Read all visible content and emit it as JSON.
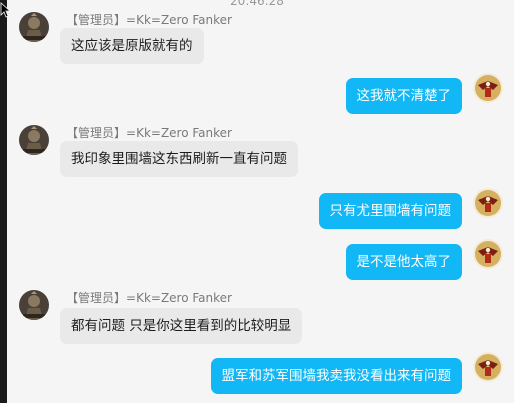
{
  "header": {
    "timestamp": "20:46:28"
  },
  "contact": {
    "tag": "【管理员】",
    "name": "=Kk=Zero Fanker",
    "avatar_icon": "warrior-avatar-icon"
  },
  "self": {
    "avatar_icon": "eagle-emblem-avatar-icon"
  },
  "messages": [
    {
      "side": "in",
      "text": "这应该是原版就有的"
    },
    {
      "side": "out",
      "text": "这我就不清楚了"
    },
    {
      "side": "in",
      "text": "我印象里围墙这东西刷新一直有问题"
    },
    {
      "side": "out",
      "text": "只有尤里围墙有问题"
    },
    {
      "side": "out",
      "text": "是不是他太高了"
    },
    {
      "side": "in",
      "text": "都有问题 只是你这里看到的比较明显"
    },
    {
      "side": "out",
      "text": "盟军和苏军围墙我卖我没看出来有问题"
    }
  ],
  "colors": {
    "incoming_bubble": "#e9e9e9",
    "outgoing_bubble": "#12b7f5",
    "name_text": "#7a7a7a"
  }
}
